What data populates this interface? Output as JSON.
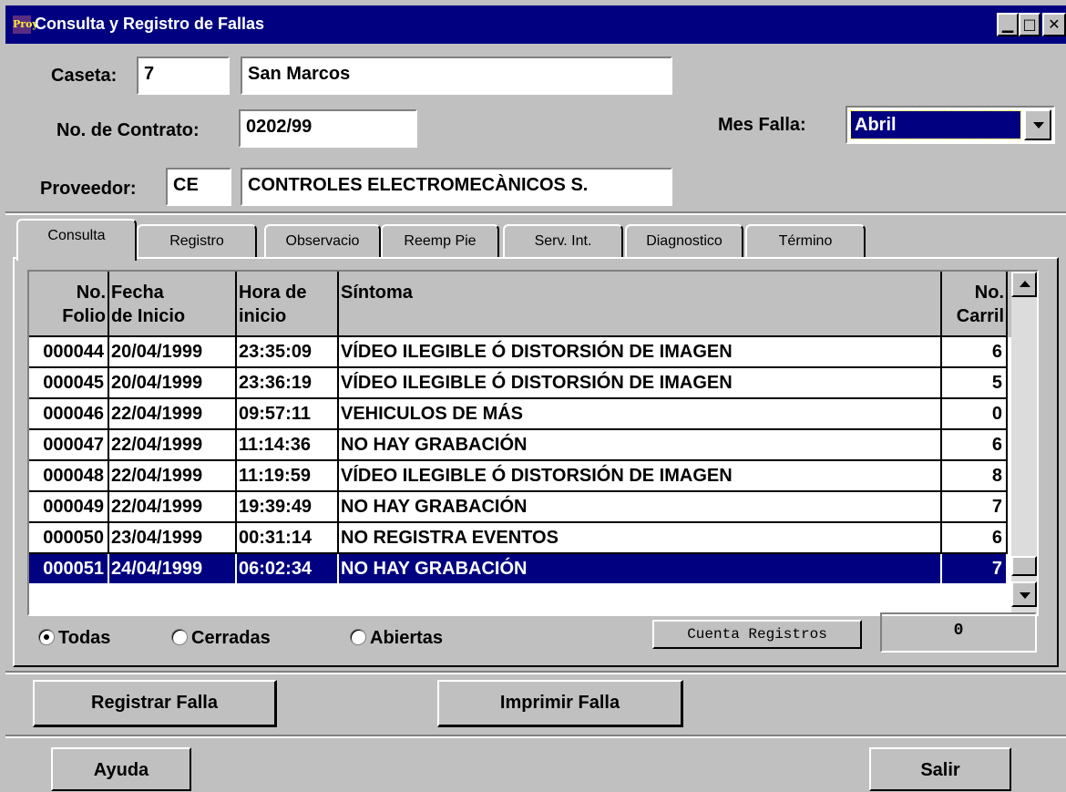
{
  "window": {
    "title": "Consulta y Registro de Fallas",
    "icon_text": "Proy",
    "controls": {
      "minimize": "▁",
      "maximize": "□",
      "close": "✕"
    }
  },
  "header": {
    "caseta_label": "Caseta:",
    "caseta_code": "7",
    "caseta_name": "San Marcos",
    "contrato_label": "No. de Contrato:",
    "contrato_value": "0202/99",
    "mes_label": "Mes  Falla:",
    "mes_value": "Abril",
    "proveedor_label": "Proveedor:",
    "proveedor_code": "CE",
    "proveedor_name": "CONTROLES ELECTROMECÀNICOS S."
  },
  "tabs": [
    {
      "label": "Consulta",
      "active": true
    },
    {
      "label": "Registro",
      "active": false
    },
    {
      "label": "Observacio",
      "active": false
    },
    {
      "label": "Reemp Pie",
      "active": false
    },
    {
      "label": "Serv. Int.",
      "active": false
    },
    {
      "label": "Diagnostico",
      "active": false
    },
    {
      "label": "Término",
      "active": false
    }
  ],
  "grid": {
    "columns": [
      {
        "line1": "No.",
        "line2": "Folio"
      },
      {
        "line1": "Fecha",
        "line2": "de Inicio"
      },
      {
        "line1": "Hora de",
        "line2": "inicio"
      },
      {
        "line1": "",
        "line2": "Síntoma"
      },
      {
        "line1": "No.",
        "line2": "Carril"
      }
    ],
    "rows": [
      {
        "folio": "000044",
        "fecha": "20/04/1999",
        "hora": "23:35:09",
        "sintoma": "VÍDEO ILEGIBLE Ó  DISTORSIÓN DE IMAGEN",
        "carril": "6",
        "selected": false
      },
      {
        "folio": "000045",
        "fecha": "20/04/1999",
        "hora": "23:36:19",
        "sintoma": "VÍDEO ILEGIBLE Ó  DISTORSIÓN DE IMAGEN",
        "carril": "5",
        "selected": false
      },
      {
        "folio": "000046",
        "fecha": "22/04/1999",
        "hora": "09:57:11",
        "sintoma": "VEHICULOS DE MÁS",
        "carril": "0",
        "selected": false
      },
      {
        "folio": "000047",
        "fecha": "22/04/1999",
        "hora": "11:14:36",
        "sintoma": "NO HAY GRABACIÓN",
        "carril": "6",
        "selected": false
      },
      {
        "folio": "000048",
        "fecha": "22/04/1999",
        "hora": "11:19:59",
        "sintoma": "VÍDEO ILEGIBLE Ó  DISTORSIÓN DE IMAGEN",
        "carril": "8",
        "selected": false
      },
      {
        "folio": "000049",
        "fecha": "22/04/1999",
        "hora": "19:39:49",
        "sintoma": "NO HAY GRABACIÓN",
        "carril": "7",
        "selected": false
      },
      {
        "folio": "000050",
        "fecha": "23/04/1999",
        "hora": "00:31:14",
        "sintoma": "NO REGISTRA EVENTOS",
        "carril": "6",
        "selected": false
      },
      {
        "folio": "000051",
        "fecha": "24/04/1999",
        "hora": "06:02:34",
        "sintoma": "NO HAY GRABACIÓN",
        "carril": "7",
        "selected": true
      }
    ]
  },
  "filters": {
    "todas": "Todas",
    "cerradas": "Cerradas",
    "abiertas": "Abiertas",
    "selected": "todas"
  },
  "count": {
    "button_label": "Cuenta Registros",
    "value": "0"
  },
  "actions": {
    "registrar": "Registrar Falla",
    "imprimir": "Imprimir Falla",
    "ayuda": "Ayuda",
    "salir": "Salir"
  },
  "colors": {
    "face": "#c0c0c0",
    "titlebar": "#000080",
    "selection": "#000080"
  }
}
